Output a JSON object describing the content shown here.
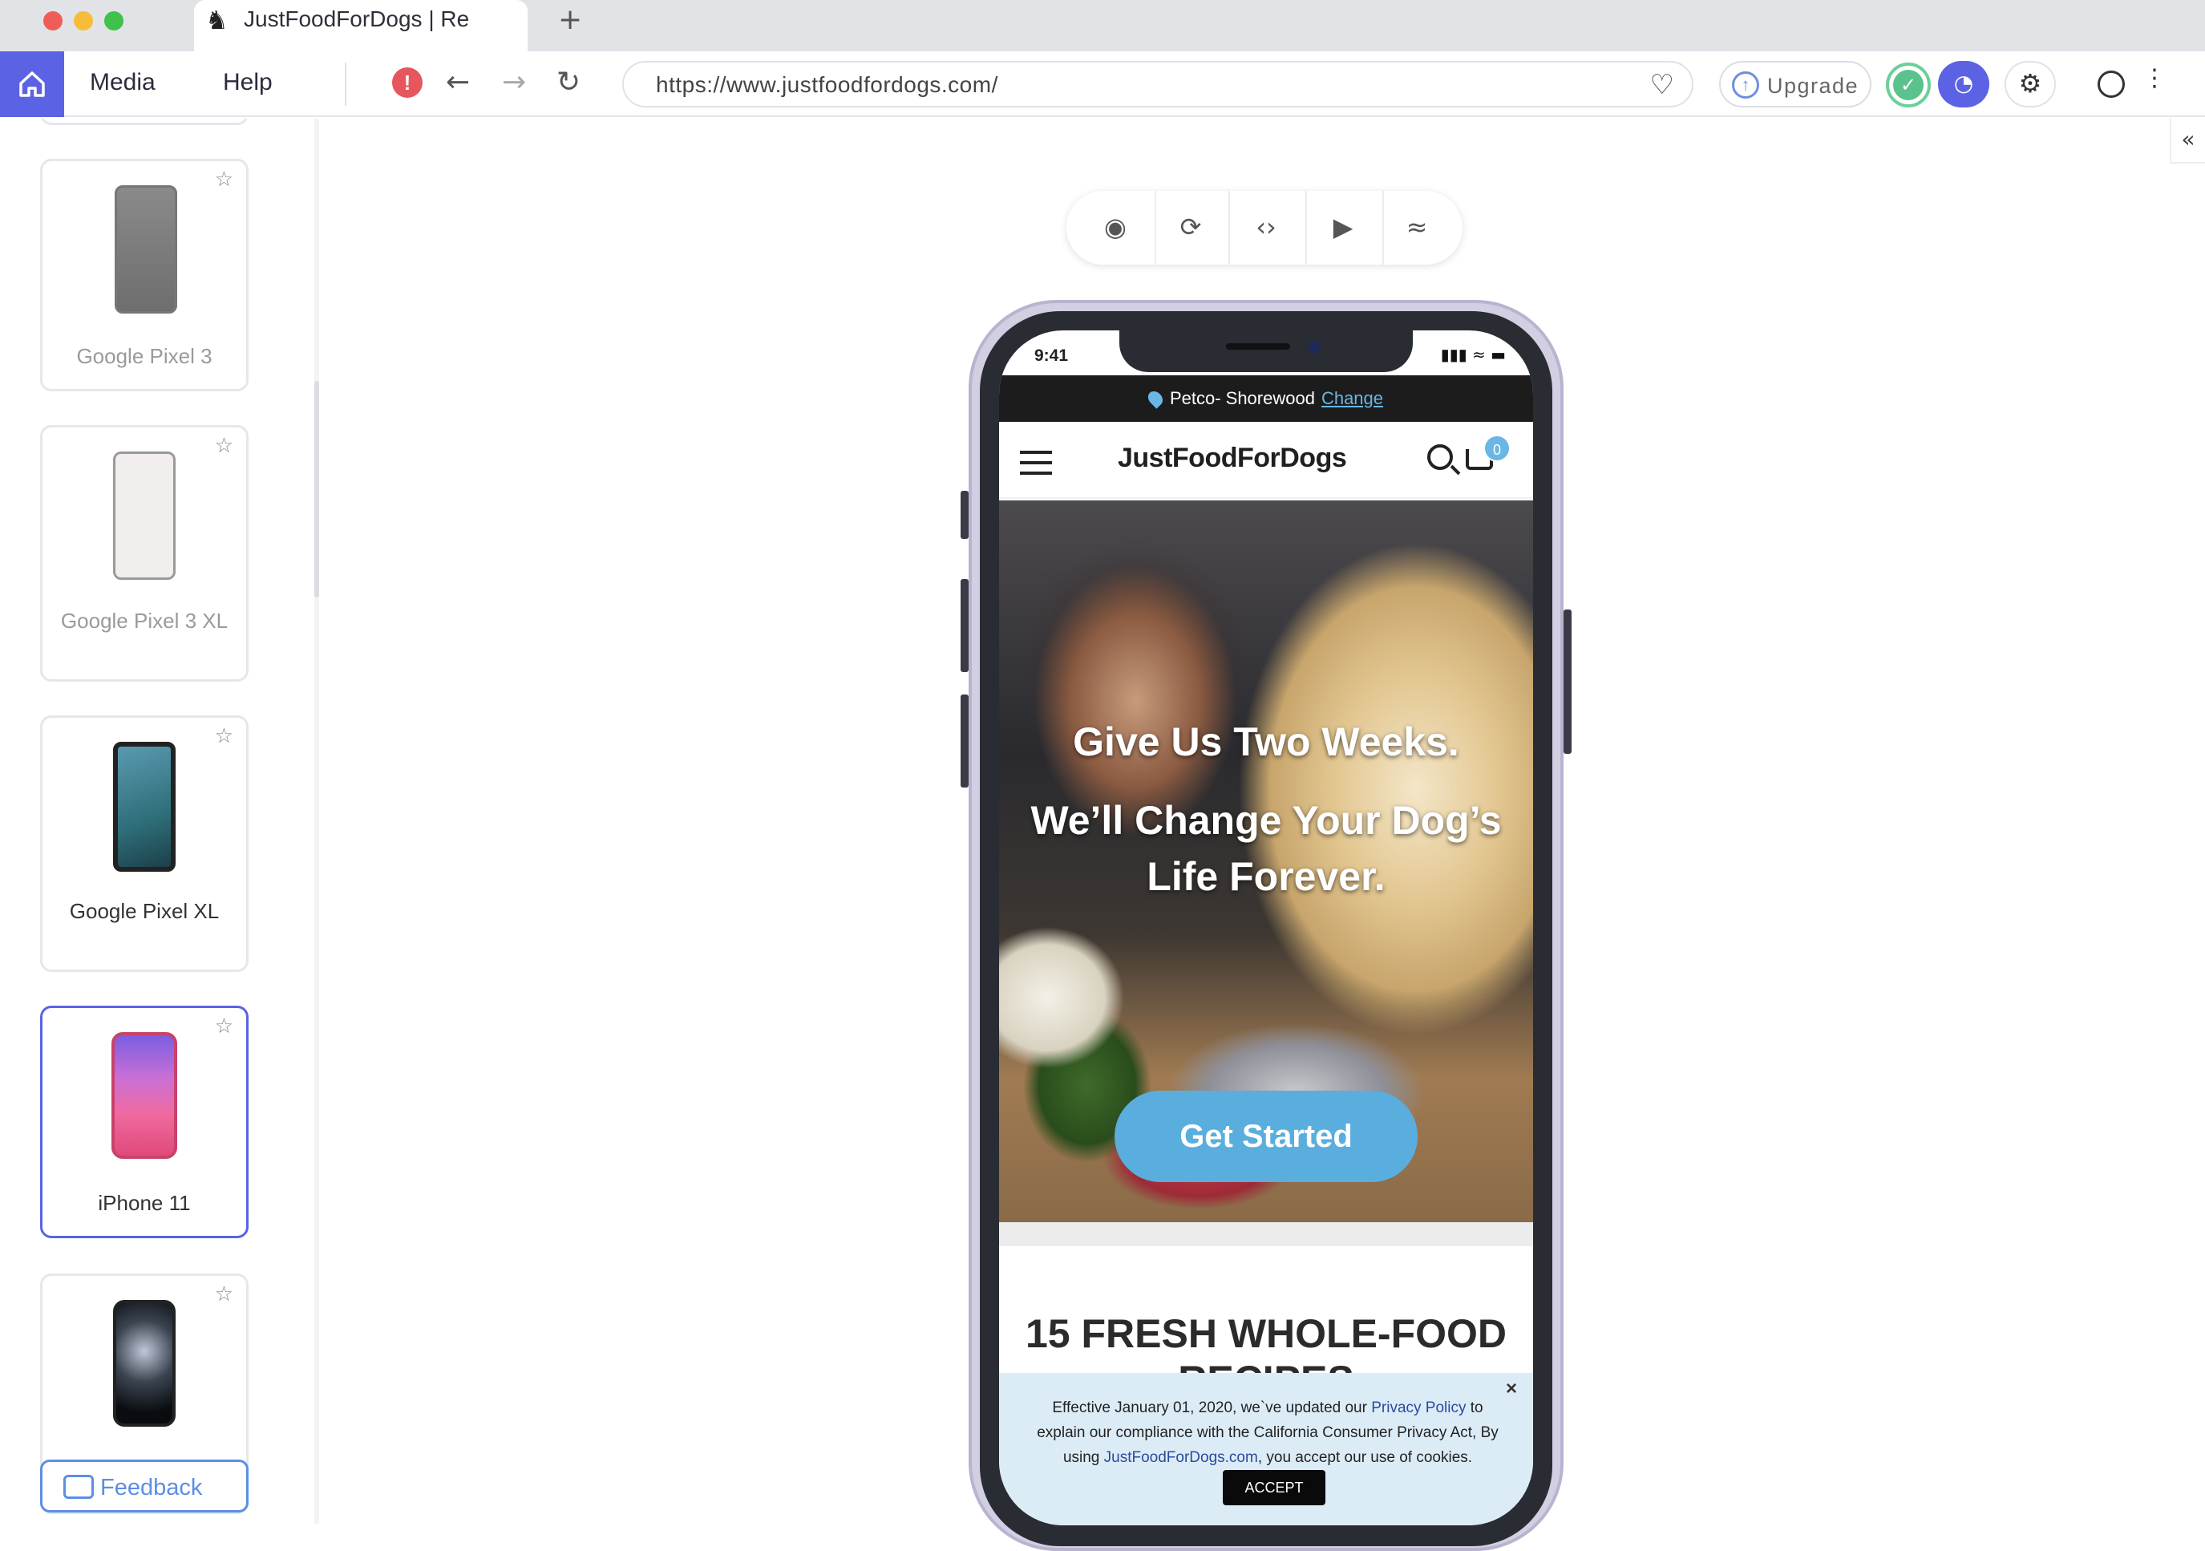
{
  "browser": {
    "tab_title": "JustFoodForDogs | Re",
    "new_tab": "+",
    "home_icon": "home-icon",
    "menu": [
      "Media",
      "Help"
    ],
    "url": "https://www.justfoodfordogs.com/",
    "upgrade_label": "Upgrade",
    "colors": {
      "accent": "#5b63e4",
      "alert": "#e7565c",
      "success": "#5ac28c"
    }
  },
  "sidebar": {
    "devices": [
      {
        "label": "Google Pixel 3",
        "state": "dimmed"
      },
      {
        "label": "Google Pixel 3 XL",
        "state": "dimmed"
      },
      {
        "label": "Google Pixel XL",
        "state": "normal"
      },
      {
        "label": "iPhone 11",
        "state": "selected"
      },
      {
        "label": "",
        "state": "normal"
      }
    ],
    "feedback_label": "Feedback"
  },
  "device_toolbar": {
    "icons": [
      "camera-icon",
      "rotate-icon",
      "code-icon",
      "video-icon",
      "wifi-icon"
    ]
  },
  "phone": {
    "status_time": "9:41",
    "store_name": "Petco- Shorewood",
    "store_change": "Change",
    "brand": "JustFoodForDogs",
    "cart_count": "0",
    "hero_line1": "Give Us Two Weeks.",
    "hero_line2a": "We’ll Change Your Dog’s",
    "hero_line2b": "Life Forever.",
    "cta": "Get Started",
    "recipes_title": "15 FRESH WHOLE-FOOD",
    "recipes_cut": "RECIPES",
    "cookie": {
      "part1": "Effective January 01, 2020, we`ve updated our",
      "privacy_link": "Privacy Policy",
      "part2": "to explain our compliance with the California Consumer Privacy Act, By using",
      "site_link": "JustFoodForDogs.com",
      "part3": ", you accept our use of cookies.",
      "accept": "ACCEPT",
      "close": "×"
    }
  }
}
